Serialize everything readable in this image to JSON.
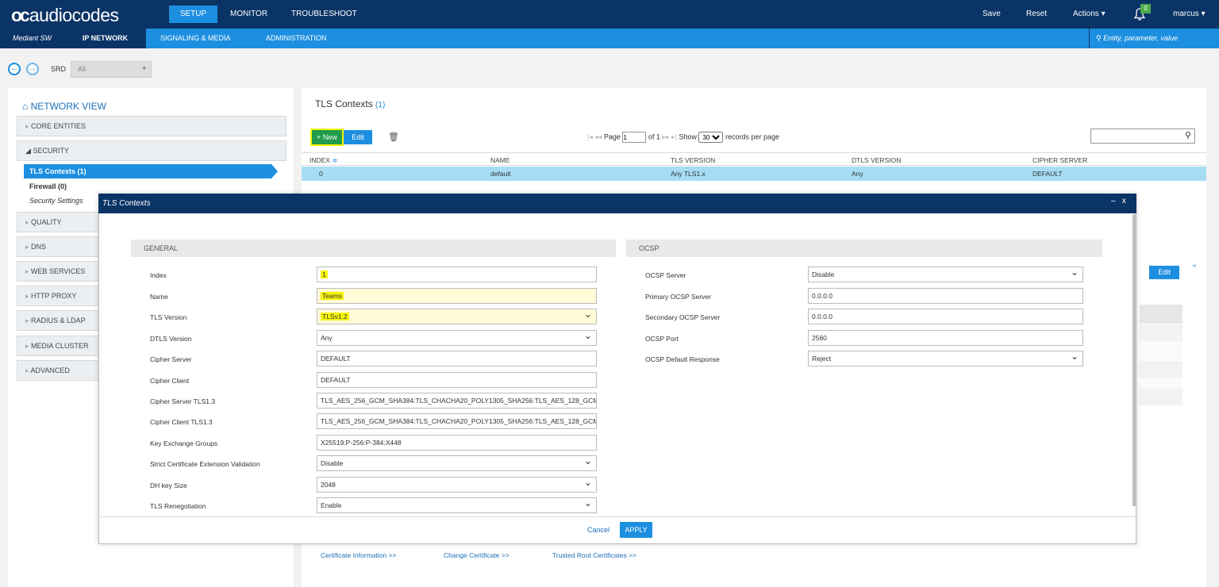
{
  "topbar": {
    "logo": "audiocodes",
    "logo_mark": "oc",
    "nav": [
      "SETUP",
      "MONITOR",
      "TROUBLESHOOT"
    ],
    "save": "Save",
    "reset": "Reset",
    "actions": "Actions",
    "notifications": "0",
    "user": "marcus"
  },
  "subnav": {
    "product": "Mediant SW",
    "items": [
      "IP NETWORK",
      "SIGNALING & MEDIA",
      "ADMINISTRATION"
    ],
    "search_placeholder": "Entity, parameter, value"
  },
  "srd": {
    "label": "SRD",
    "value": "All"
  },
  "network_view": {
    "title": "NETWORK VIEW",
    "sections": [
      "CORE ENTITIES",
      "SECURITY",
      "QUALITY",
      "DNS",
      "WEB SERVICES",
      "HTTP PROXY",
      "RADIUS & LDAP",
      "MEDIA CLUSTER",
      "ADVANCED"
    ],
    "security_items": [
      "TLS Contexts (1)",
      "Firewall (0)",
      "Security Settings"
    ]
  },
  "main": {
    "title": "TLS Contexts",
    "count": "(1)",
    "new_label": "+ New",
    "edit_label": "Edit",
    "page_label": "Page",
    "page_value": "1",
    "of_label": "of 1",
    "show_label": "Show",
    "per_page": "30",
    "records_label": "records per page",
    "columns": [
      "INDEX",
      "NAME",
      "TLS VERSION",
      "DTLS VERSION",
      "CIPHER SERVER"
    ],
    "rows": [
      [
        "0",
        "default",
        "Any TLS1.x",
        "Any",
        "DEFAULT"
      ]
    ],
    "edit2_label": "Edit",
    "links": [
      "Certificate Information >>",
      "Change Certificate >>",
      "Trusted Root Certificates >>"
    ]
  },
  "modal": {
    "title": "TLS Contexts",
    "general_title": "GENERAL",
    "ocsp_title": "OCSP",
    "general_fields": [
      {
        "label": "Index",
        "value": "1"
      },
      {
        "label": "Name",
        "value": "Teams"
      },
      {
        "label": "TLS Version",
        "value": "TLSv1.2"
      },
      {
        "label": "DTLS Version",
        "value": "Any"
      },
      {
        "label": "Cipher Server",
        "value": "DEFAULT"
      },
      {
        "label": "Cipher Client",
        "value": "DEFAULT"
      },
      {
        "label": "Cipher Server TLS1.3",
        "value": "TLS_AES_256_GCM_SHA384:TLS_CHACHA20_POLY1305_SHA256:TLS_AES_128_GCM_"
      },
      {
        "label": "Cipher Client TLS1.3",
        "value": "TLS_AES_256_GCM_SHA384:TLS_CHACHA20_POLY1305_SHA256:TLS_AES_128_GCM_"
      },
      {
        "label": "Key Exchange Groups",
        "value": "X25519:P-256:P-384:X448"
      },
      {
        "label": "Strict Certificate Extension Validation",
        "value": "Disable"
      },
      {
        "label": "DH key Size",
        "value": "2048"
      },
      {
        "label": "TLS Renegotiation",
        "value": "Enable"
      }
    ],
    "ocsp_fields": [
      {
        "label": "OCSP Server",
        "value": "Disable"
      },
      {
        "label": "Primary OCSP Server",
        "value": "0.0.0.0"
      },
      {
        "label": "Secondary OCSP Server",
        "value": "0.0.0.0"
      },
      {
        "label": "OCSP Port",
        "value": "2560"
      },
      {
        "label": "OCSP Default Response",
        "value": "Reject"
      }
    ],
    "cancel_label": "Cancel",
    "apply_label": "APPLY"
  },
  "colors": {
    "navy": "#0b3466",
    "blue": "#1d8fe0",
    "highlight": "#f5f50a",
    "green": "#1f9b4a"
  }
}
